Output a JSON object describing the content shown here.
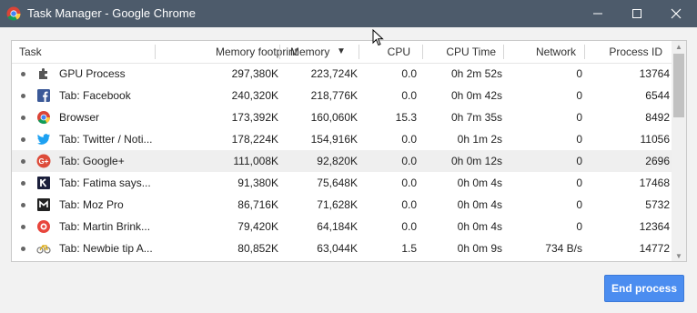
{
  "window": {
    "title": "Task Manager - Google Chrome"
  },
  "columns": {
    "task": "Task",
    "memory_footprint": "Memory footprint",
    "memory": "Memory",
    "memory_sort": "▼",
    "cpu": "CPU",
    "cpu_time": "CPU Time",
    "network": "Network",
    "process_id": "Process ID"
  },
  "rows": [
    {
      "task": "GPU Process",
      "icon": "puzzle-icon",
      "memory_footprint": "297,380K",
      "memory": "223,724K",
      "cpu": "0.0",
      "cpu_time": "0h 2m 52s",
      "network": "0",
      "process_id": "13764"
    },
    {
      "task": "Tab: Facebook",
      "icon": "facebook-icon",
      "memory_footprint": "240,320K",
      "memory": "218,776K",
      "cpu": "0.0",
      "cpu_time": "0h 0m 42s",
      "network": "0",
      "process_id": "6544"
    },
    {
      "task": "Browser",
      "icon": "chrome-icon",
      "memory_footprint": "173,392K",
      "memory": "160,060K",
      "cpu": "15.3",
      "cpu_time": "0h 7m 35s",
      "network": "0",
      "process_id": "8492"
    },
    {
      "task": "Tab: Twitter / Noti...",
      "icon": "twitter-icon",
      "memory_footprint": "178,224K",
      "memory": "154,916K",
      "cpu": "0.0",
      "cpu_time": "0h 1m 2s",
      "network": "0",
      "process_id": "11056"
    },
    {
      "task": "Tab: Google+",
      "icon": "google-plus-icon",
      "memory_footprint": "111,008K",
      "memory": "92,820K",
      "cpu": "0.0",
      "cpu_time": "0h 0m 12s",
      "network": "0",
      "process_id": "2696"
    },
    {
      "task": "Tab: Fatima says...",
      "icon": "k-logo-icon",
      "memory_footprint": "91,380K",
      "memory": "75,648K",
      "cpu": "0.0",
      "cpu_time": "0h 0m 4s",
      "network": "0",
      "process_id": "17468"
    },
    {
      "task": "Tab: Moz Pro",
      "icon": "moz-icon",
      "memory_footprint": "86,716K",
      "memory": "71,628K",
      "cpu": "0.0",
      "cpu_time": "0h 0m 4s",
      "network": "0",
      "process_id": "5732"
    },
    {
      "task": "Tab: Martin Brink...",
      "icon": "red-circle-icon",
      "memory_footprint": "79,420K",
      "memory": "64,184K",
      "cpu": "0.0",
      "cpu_time": "0h 0m 4s",
      "network": "0",
      "process_id": "12364"
    },
    {
      "task": "Tab: Newbie tip A...",
      "icon": "bicycle-icon",
      "memory_footprint": "80,852K",
      "memory": "63,044K",
      "cpu": "1.5",
      "cpu_time": "0h 0m 9s",
      "network": "734 B/s",
      "process_id": "14772"
    }
  ],
  "selected_row": 4,
  "actions": {
    "end_process": "End process"
  },
  "colors": {
    "titlebar": "#4d5b6b",
    "accent": "#4b8df0",
    "selected_row": "#efefef"
  }
}
